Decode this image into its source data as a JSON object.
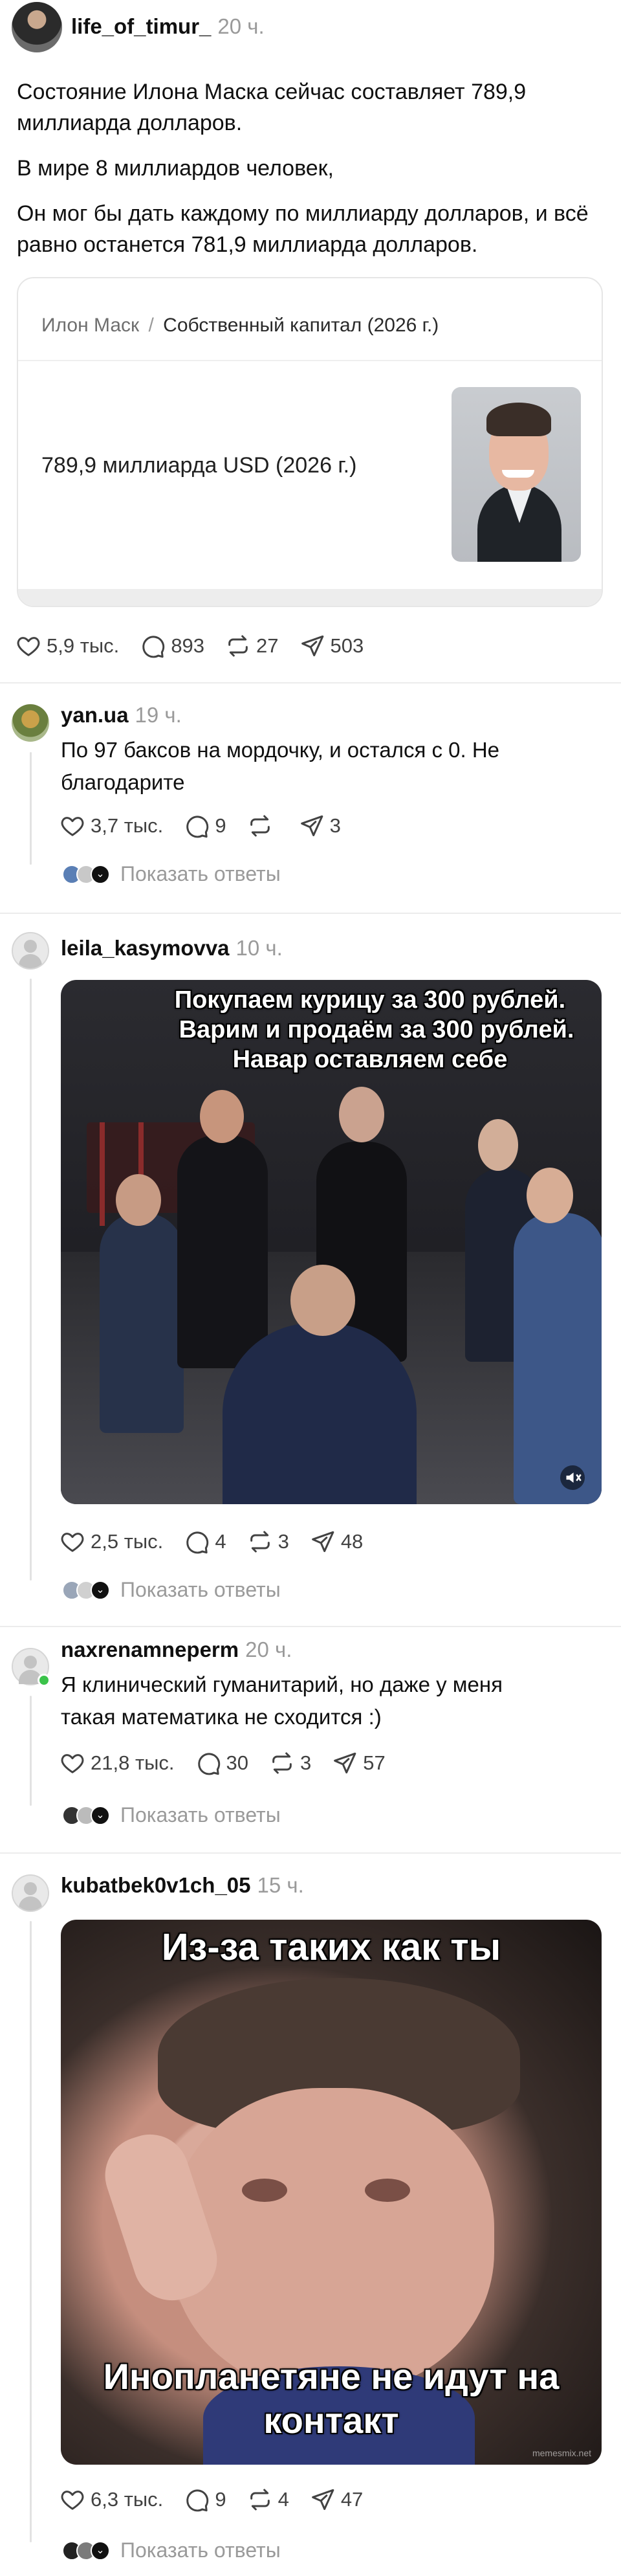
{
  "post": {
    "username": "life_of_timur_",
    "time": "20 ч.",
    "paragraphs": [
      "Состояние Илона Маска сейчас составляет 789,9 миллиарда долларов.",
      "В мире 8 миллиардов человек,",
      "Он мог бы дать каждому по миллиарду долларов, и всё равно останется 781,9 миллиарда долларов."
    ],
    "card": {
      "breadcrumb_1": "Илон Маск",
      "separator": "/",
      "breadcrumb_2": "Собственный капитал (2026 г.)",
      "value": "789,9 миллиарда USD (2026 г.)"
    },
    "likes": "5,9 тыс.",
    "comments": "893",
    "reposts": "27",
    "shares": "503"
  },
  "replies": [
    {
      "username": "yan.ua",
      "time": "19 ч.",
      "text": "По 97 баксов на мордочку, и остался с 0. Не благодарите",
      "likes": "3,7 тыс.",
      "comments": "9",
      "reposts": "",
      "shares": "3",
      "show_replies": "Показать ответы"
    },
    {
      "username": "leila_kasymovva",
      "time": "10 ч.",
      "meme_lines": [
        "Покупаем курицу за 300 рублей.",
        "Варим и продаём за 300 рублей.",
        "Навар оставляем себе"
      ],
      "likes": "2,5 тыс.",
      "comments": "4",
      "reposts": "3",
      "shares": "48",
      "show_replies": "Показать ответы"
    },
    {
      "username": "naxrenamneperm",
      "time": "20 ч.",
      "text": "Я клинический гуманитарий, но даже у меня такая математика не сходится :)",
      "likes": "21,8 тыс.",
      "comments": "30",
      "reposts": "3",
      "shares": "57",
      "show_replies": "Показать ответы"
    },
    {
      "username": "kubatbek0v1ch_05",
      "time": "15 ч.",
      "meme_top": "Из-за таких как ты",
      "meme_bottom_1": "Инопланетяне не идут на",
      "meme_bottom_2": "контакт",
      "watermark": "memesmix.net",
      "likes": "6,3 тыс.",
      "comments": "9",
      "reposts": "4",
      "shares": "47",
      "show_replies": "Показать ответы"
    }
  ],
  "colors": {
    "text": "#101010",
    "muted": "#9a9a9a",
    "icon": "#424242",
    "online": "#3bc34a"
  }
}
